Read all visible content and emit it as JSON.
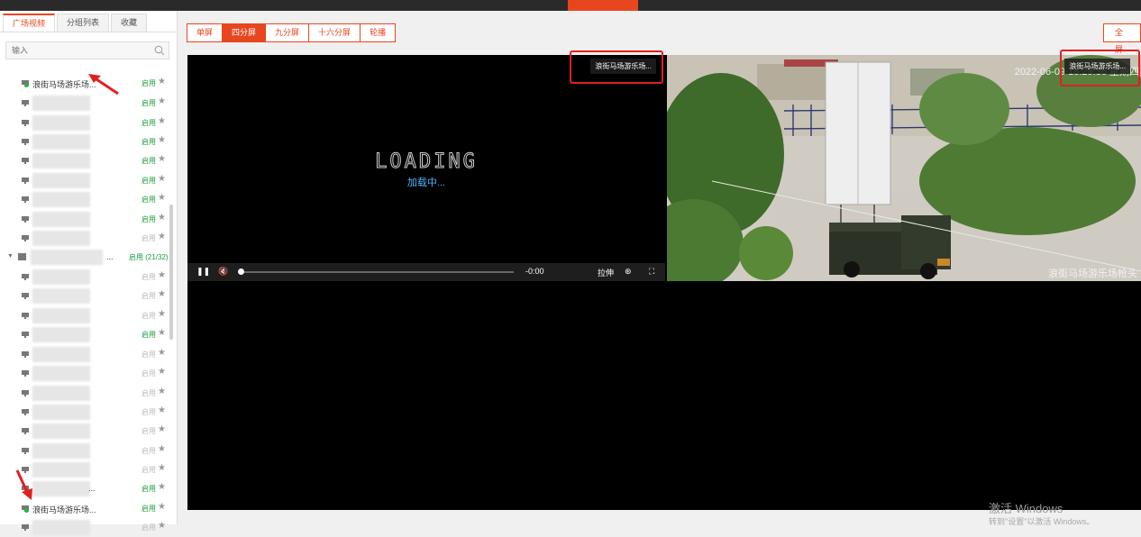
{
  "sidebar": {
    "tabs": [
      {
        "label": "广场视频",
        "active": true
      },
      {
        "label": "分组列表",
        "active": false
      },
      {
        "label": "收藏",
        "active": false
      }
    ],
    "search_placeholder": "输入",
    "status_on": "启用",
    "status_off": "启用",
    "first_item_name": "浪街马场游乐场...",
    "second_item_name": "浪街马场游乐场...",
    "group_label": "启用 (21/32)",
    "group_name_suffix": "...",
    "item_above_last_suffix": "..."
  },
  "toolbar": {
    "layouts": [
      "单屏",
      "四分屏",
      "九分屏",
      "十六分屏",
      "轮播"
    ],
    "active_layout": "四分屏",
    "fullscreen_label": "全屏"
  },
  "player1": {
    "title": "浪街马场游乐场...",
    "loading_text": "LOADING",
    "loading_sub": "加载中...",
    "time": "-0:00",
    "stretch_label": "拉伸"
  },
  "player2": {
    "title": "浪街马场游乐场...",
    "timestamp": "2022-06-09 18:29:36 星期四",
    "caption": "浪街马场游乐场枪头"
  },
  "watermark": {
    "line1": "激活 Windows",
    "line2": "转到\"设置\"以激活 Windows。"
  },
  "colors": {
    "accent": "#e8461e",
    "status_on": "#1a9c3e",
    "status_off": "#bbbbbb",
    "annotation": "#e02020"
  }
}
